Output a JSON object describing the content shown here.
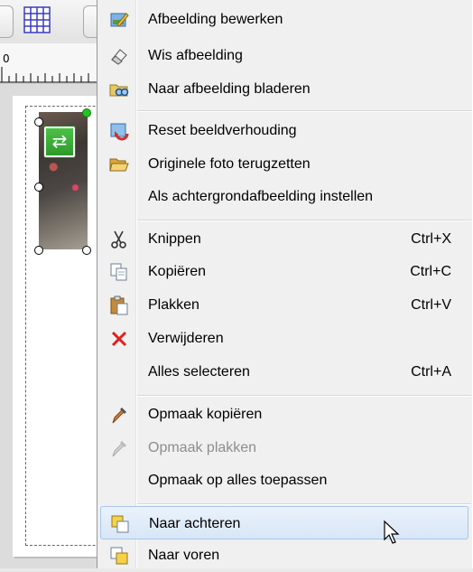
{
  "menu": {
    "items": [
      {
        "id": "edit-image",
        "label": "Afbeelding bewerken",
        "icon": "pencil-image-icon",
        "shortcut": ""
      },
      {
        "id": "clear-image",
        "label": "Wis afbeelding",
        "icon": "eraser-icon",
        "shortcut": ""
      },
      {
        "id": "browse-image",
        "label": "Naar afbeelding bladeren",
        "icon": "browse-image-icon",
        "shortcut": ""
      },
      {
        "id": "reset-aspect",
        "label": "Reset beeldverhouding",
        "icon": "reset-aspect-icon",
        "shortcut": ""
      },
      {
        "id": "restore-photo",
        "label": "Originele foto terugzetten",
        "icon": "open-folder-icon",
        "shortcut": ""
      },
      {
        "id": "set-background",
        "label": "Als achtergrondafbeelding instellen",
        "icon": "",
        "shortcut": ""
      },
      {
        "id": "cut",
        "label": "Knippen",
        "icon": "scissors-icon",
        "shortcut": "Ctrl+X"
      },
      {
        "id": "copy",
        "label": "Kopiëren",
        "icon": "copy-icon",
        "shortcut": "Ctrl+C"
      },
      {
        "id": "paste",
        "label": "Plakken",
        "icon": "paste-icon",
        "shortcut": "Ctrl+V"
      },
      {
        "id": "delete",
        "label": "Verwijderen",
        "icon": "delete-x-icon",
        "shortcut": ""
      },
      {
        "id": "select-all",
        "label": "Alles selecteren",
        "icon": "",
        "shortcut": "Ctrl+A"
      },
      {
        "id": "copy-format",
        "label": "Opmaak kopiëren",
        "icon": "eyedropper-icon",
        "shortcut": ""
      },
      {
        "id": "paste-format",
        "label": "Opmaak plakken",
        "icon": "eyedropper-disabled-icon",
        "shortcut": "",
        "disabled": true
      },
      {
        "id": "apply-format-all",
        "label": "Opmaak op alles toepassen",
        "icon": "",
        "shortcut": ""
      },
      {
        "id": "send-backward",
        "label": "Naar achteren",
        "icon": "send-backward-icon",
        "shortcut": "",
        "highlighted": true
      },
      {
        "id": "bring-forward",
        "label": "Naar voren",
        "icon": "bring-forward-icon",
        "shortcut": ""
      }
    ]
  },
  "ruler": {
    "origin_label": "0"
  },
  "colors": {
    "menu_bg": "#f0f0f0",
    "highlight_bg": "#d8e6f6",
    "highlight_border": "#a9c6ea",
    "disabled_text": "#8d8d8d",
    "delete_red": "#e02020"
  }
}
